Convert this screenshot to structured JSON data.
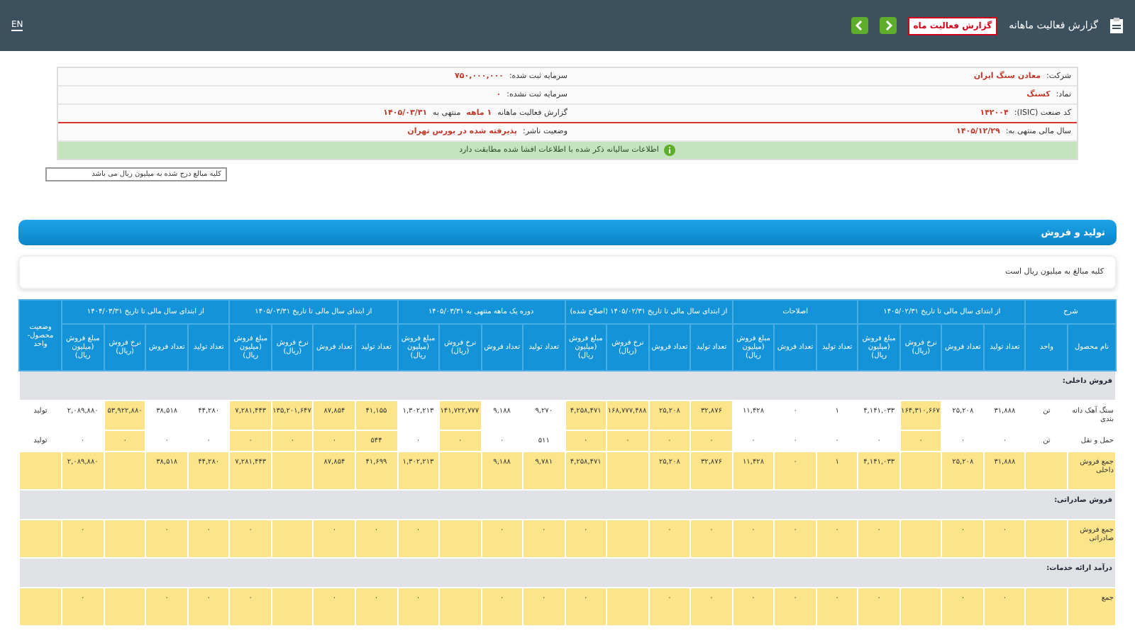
{
  "header": {
    "title": "گزارش فعالیت ماهانه",
    "report_button": "گزارش فعالیت ماه",
    "language": "EN"
  },
  "info": {
    "rows": [
      {
        "right_label": "شرکت:",
        "right_value": "معادن سنگ ایران",
        "left_label": "سرمایه ثبت شده:",
        "left_value": "۷۵۰,۰۰۰,۰۰۰"
      },
      {
        "right_label": "نماد:",
        "right_value": "کسنگ",
        "left_label": "سرمایه ثبت نشده:",
        "left_value": "۰"
      },
      {
        "right_label": "کد صنعت (ISIC):",
        "right_value": "۱۴۲۰۰۴",
        "left_label": "گزارش فعالیت ماهانه",
        "left_value": "۱ ماهه",
        "left_extra_label": "منتهی به",
        "left_extra_value": "۱۴۰۵/۰۳/۳۱"
      },
      {
        "right_label": "سال مالی منتهی به:",
        "right_value": "۱۴۰۵/۱۲/۲۹",
        "left_label": "وضعیت ناشر:",
        "left_value": "پذیرفته شده در بورس تهران"
      }
    ],
    "notice": "اطلاعات سالیانه ذکر شده با اطلاعات افشا شده مطابقت دارد"
  },
  "unit_select": {
    "value": "کلیه مبالغ درج شده به میلیون ریال می باشد"
  },
  "section": {
    "title": "تولید و فروش",
    "note": "کلیه مبالغ به میلیون ریال است"
  },
  "table": {
    "groups": [
      {
        "label": "شرح",
        "columns": [
          {
            "label": "نام محصول",
            "highlighted": false
          },
          {
            "label": "واحد",
            "highlighted": false
          }
        ]
      },
      {
        "label": "از ابتدای سال مالی تا تاریخ ۱۴۰۵/۰۲/۳۱",
        "columns": [
          {
            "label": "تعداد تولید",
            "highlighted": false
          },
          {
            "label": "تعداد فروش",
            "highlighted": false
          },
          {
            "label": "نرخ فروش (ریال)",
            "highlighted": true
          },
          {
            "label": "مبلغ فروش (میلیون ریال)",
            "highlighted": false
          }
        ]
      },
      {
        "label": "اصلاحات",
        "columns": [
          {
            "label": "تعداد تولید",
            "highlighted": false
          },
          {
            "label": "تعداد فروش",
            "highlighted": false
          },
          {
            "label": "مبلغ فروش (میلیون ریال)",
            "highlighted": false
          }
        ]
      },
      {
        "label": "از ابتدای سال مالی تا تاریخ ۱۴۰۵/۰۲/۳۱ (اصلاح شده)",
        "columns": [
          {
            "label": "تعداد تولید",
            "highlighted": true
          },
          {
            "label": "تعداد فروش",
            "highlighted": true
          },
          {
            "label": "نرخ فروش (ریال)",
            "highlighted": true
          },
          {
            "label": "مبلغ فروش (میلیون ریال)",
            "highlighted": true
          }
        ]
      },
      {
        "label": "دوره یک ماهه منتهی به ۱۴۰۵/۰۳/۳۱",
        "columns": [
          {
            "label": "تعداد تولید",
            "highlighted": false
          },
          {
            "label": "تعداد فروش",
            "highlighted": false
          },
          {
            "label": "نرخ فروش (ریال)",
            "highlighted": true
          },
          {
            "label": "مبلغ فروش (میلیون ریال)",
            "highlighted": false
          }
        ]
      },
      {
        "label": "از ابتدای سال مالی تا تاریخ ۱۴۰۵/۰۳/۳۱",
        "columns": [
          {
            "label": "تعداد تولید",
            "highlighted": true
          },
          {
            "label": "تعداد فروش",
            "highlighted": true
          },
          {
            "label": "نرخ فروش (ریال)",
            "highlighted": true
          },
          {
            "label": "مبلغ فروش (میلیون ریال)",
            "highlighted": true
          }
        ]
      },
      {
        "label": "از ابتدای سال مالی تا تاریخ ۱۴۰۴/۰۳/۳۱",
        "columns": [
          {
            "label": "تعداد تولید",
            "highlighted": false
          },
          {
            "label": "تعداد فروش",
            "highlighted": false
          },
          {
            "label": "نرخ فروش (ریال)",
            "highlighted": true
          },
          {
            "label": "مبلغ فروش (میلیون ریال)",
            "highlighted": false
          }
        ]
      },
      {
        "label": "وضعیت محصول- واحد"
      }
    ],
    "rows": [
      {
        "kind": "section",
        "label": "فروش داخلی:"
      },
      {
        "kind": "item",
        "cells": [
          "سنگ آهک دانه بندی",
          "تن",
          "۳۱,۸۸۸",
          "۲۵,۲۰۸",
          "۱۶۴,۳۱۰,۶۶۷",
          "۴,۱۴۱,۰۳۳",
          "۱",
          "۰",
          "۱۱,۴۲۸",
          "۳۲,۸۷۶",
          "۲۵,۲۰۸",
          "۱۶۸,۷۷۷,۴۸۸",
          "۴,۲۵۸,۴۷۱",
          "۹,۲۷۰",
          "۹,۱۸۸",
          "۱۴۱,۷۲۲,۷۷۷",
          "۱,۳۰۲,۲۱۳",
          "۴۱,۱۵۵",
          "۸۷,۸۵۴",
          "۱۳۵,۲۰۱,۶۴۷",
          "۷,۲۸۱,۴۴۳",
          "۴۴,۲۸۰",
          "۳۸,۵۱۸",
          "۵۳,۹۲۲,۸۸۰",
          "۲,۰۸۹,۸۸۰",
          "تولید"
        ]
      },
      {
        "kind": "item",
        "cells": [
          "حمل و نقل",
          "تن",
          "۰",
          "۰",
          "۰",
          "۰",
          "۰",
          "۰",
          "۰",
          "۰",
          "۰",
          "۰",
          "۰",
          "۵۱۱",
          "۰",
          "۰",
          "۰",
          "۵۴۴",
          "۰",
          "۰",
          "۰",
          "۰",
          "۰",
          "۰",
          "۰",
          "تولید"
        ]
      },
      {
        "kind": "total",
        "cells": [
          "جمع فروش داخلی",
          null,
          "۳۱,۸۸۸",
          "۲۵,۲۰۸",
          null,
          "۴,۱۴۱,۰۳۳",
          "۱",
          "۰",
          "۱۱,۴۲۸",
          "۳۲,۸۷۶",
          "۲۵,۲۰۸",
          null,
          "۴,۲۵۸,۴۷۱",
          "۹,۷۸۱",
          "۹,۱۸۸",
          null,
          "۱,۳۰۲,۲۱۳",
          "۴۱,۶۹۹",
          "۸۷,۸۵۴",
          null,
          "۷,۲۸۱,۴۴۳",
          "۴۴,۲۸۰",
          "۳۸,۵۱۸",
          null,
          "۲,۰۸۹,۸۸۰",
          null
        ]
      },
      {
        "kind": "section",
        "label": "فروش صادراتی:"
      },
      {
        "kind": "total",
        "cells": [
          "جمع فروش صادراتی",
          null,
          "۰",
          "۰",
          null,
          "۰",
          "۰",
          "۰",
          "۰",
          "۰",
          "۰",
          null,
          "۰",
          "۰",
          "۰",
          null,
          "۰",
          "۰",
          "۰",
          null,
          "۰",
          "۰",
          "۰",
          null,
          "۰",
          null
        ]
      },
      {
        "kind": "section",
        "label": "درآمد ارائه خدمات:"
      },
      {
        "kind": "total",
        "cells": [
          "جمع",
          null,
          "۰",
          "۰",
          null,
          "۰",
          "۰",
          "۰",
          "۰",
          "۰",
          "۰",
          null,
          "۰",
          "۰",
          "۰",
          null,
          "۰",
          "۰",
          "۰",
          null,
          "۰",
          "۰",
          "۰",
          null,
          "۰",
          null
        ]
      }
    ]
  }
}
